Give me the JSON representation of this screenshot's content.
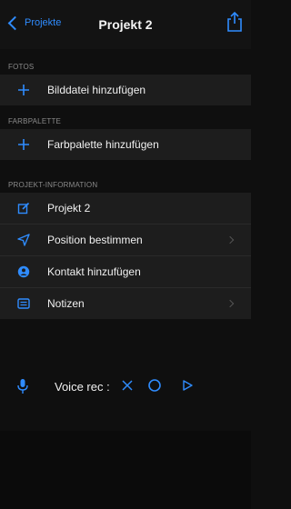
{
  "nav": {
    "back_label": "Projekte",
    "title": "Projekt 2"
  },
  "sections": {
    "fotos": {
      "header": "FOTOS",
      "add_label": "Bilddatei hinzufügen"
    },
    "farbpalette": {
      "header": "FARBPALETTE",
      "add_label": "Farbpalette hinzufügen"
    },
    "projekt_info": {
      "header": "PROJEKT-INFORMATION",
      "items": [
        {
          "label": "Projekt 2",
          "icon": "edit-icon"
        },
        {
          "label": "Position bestimmen",
          "icon": "location-arrow-icon"
        },
        {
          "label": "Kontakt hinzufügen",
          "icon": "contact-icon"
        },
        {
          "label": "Notizen",
          "icon": "notes-icon"
        }
      ]
    }
  },
  "voice": {
    "label": "Voice rec :"
  },
  "colors": {
    "accent": "#2f8cff",
    "background": "#0f0f0f",
    "row_background": "#1d1d1d",
    "header_text": "#8a8a8a"
  }
}
